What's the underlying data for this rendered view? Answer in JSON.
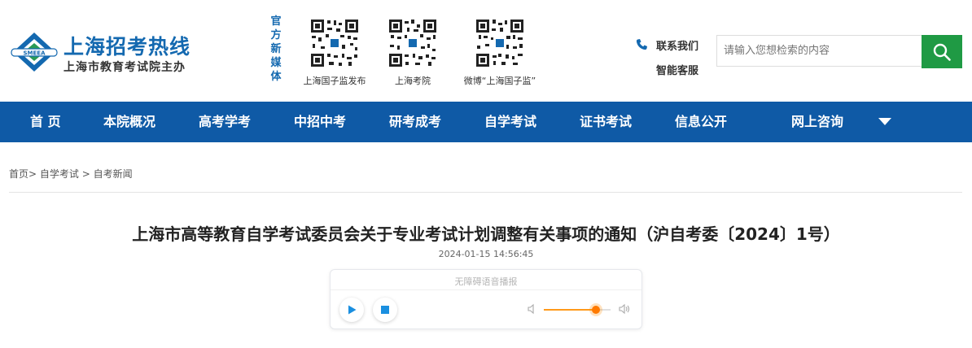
{
  "site": {
    "title": "上海招考热线",
    "subtitle": "上海市教育考试院主办",
    "logo_text": "SMEEA",
    "brand_color": "#1469b0"
  },
  "media": {
    "label": "官方新媒体",
    "qrs": [
      {
        "caption": "上海国子监发布"
      },
      {
        "caption": "上海考院"
      },
      {
        "caption": "微博“上海国子监”"
      }
    ]
  },
  "contact": {
    "contact_label": "联系我们",
    "service_label": "智能客服",
    "icon": "phone-icon"
  },
  "search": {
    "placeholder": "请输入您想检索的内容",
    "button_icon": "search-icon",
    "button_color": "#1f9a44"
  },
  "nav": {
    "color": "#0f5aa6",
    "items": [
      "首 页",
      "本院概况",
      "高考学考",
      "中招中考",
      "研考成考",
      "自学考试",
      "证书考试",
      "信息公开",
      "网上咨询"
    ]
  },
  "breadcrumb": {
    "home": "首页",
    "level1": "自学考试",
    "level2": "自考新闻"
  },
  "article": {
    "title": "上海市高等教育自学考试委员会关于专业考试计划调整有关事项的通知（沪自考委〔2024〕1号）",
    "date": "2024-01-15 14:56:45"
  },
  "player": {
    "title": "无障碍语音播报",
    "volume": 0.78,
    "accent": "#ff7a00"
  }
}
